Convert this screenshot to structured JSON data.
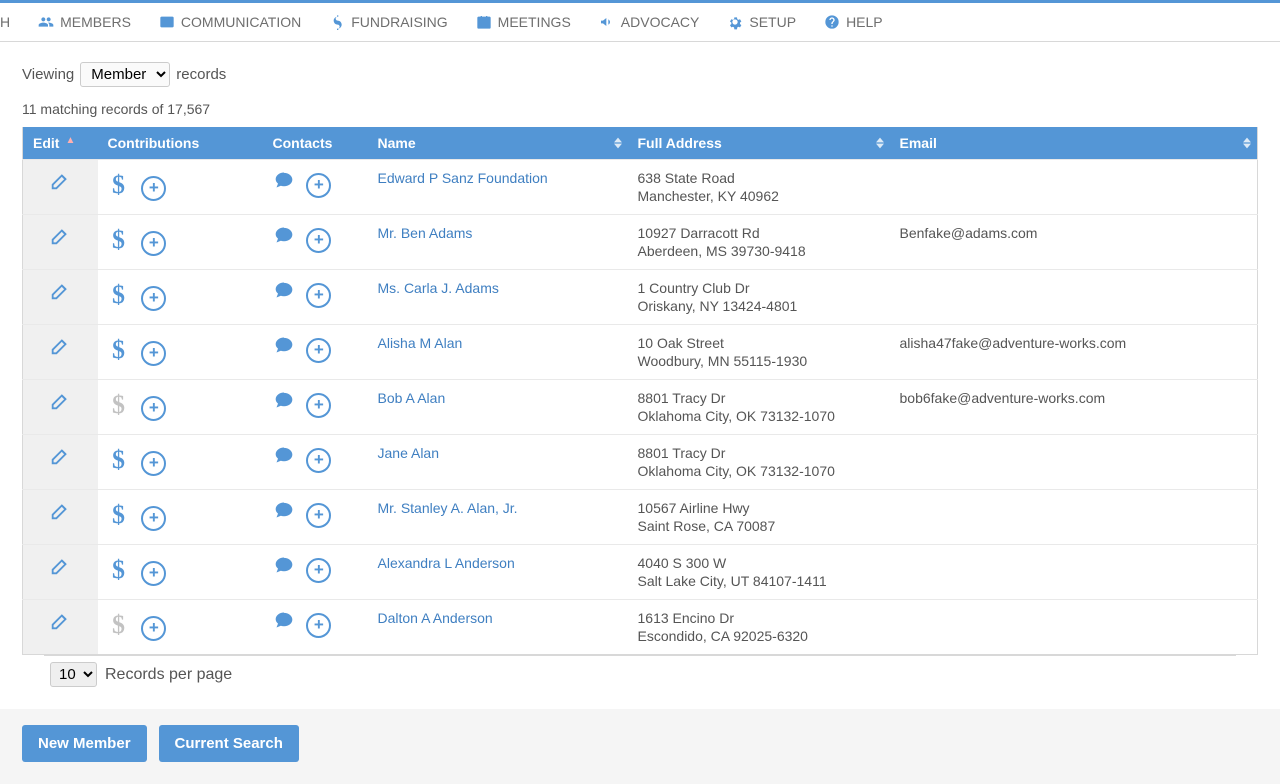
{
  "nav": {
    "search_fragment": "H",
    "members": "MEMBERS",
    "communication": "COMMUNICATION",
    "fundraising": "FUNDRAISING",
    "meetings": "MEETINGS",
    "advocacy": "ADVOCACY",
    "setup": "SETUP",
    "help": "HELP"
  },
  "viewing": {
    "label_prefix": "Viewing",
    "select_value": "Member",
    "label_suffix": "records",
    "match_count": "11 matching records of 17,567"
  },
  "columns": {
    "edit": "Edit",
    "contributions": "Contributions",
    "contacts": "Contacts",
    "name": "Name",
    "full_address": "Full Address",
    "email": "Email"
  },
  "rows": [
    {
      "name": "Edward P Sanz Foundation",
      "addr1": "638 State Road",
      "addr2": "Manchester, KY 40962",
      "email": "",
      "dollar_faded": false
    },
    {
      "name": "Mr. Ben Adams",
      "addr1": "10927 Darracott Rd",
      "addr2": "Aberdeen, MS 39730-9418",
      "email": "Benfake@adams.com",
      "dollar_faded": false
    },
    {
      "name": "Ms. Carla J. Adams",
      "addr1": "1 Country Club Dr",
      "addr2": "Oriskany, NY 13424-4801",
      "email": "",
      "dollar_faded": false
    },
    {
      "name": "Alisha M Alan",
      "addr1": "10 Oak Street",
      "addr2": "Woodbury, MN 55115-1930",
      "email": "alisha47fake@adventure-works.com",
      "dollar_faded": false
    },
    {
      "name": "Bob A Alan",
      "addr1": "8801 Tracy Dr",
      "addr2": "Oklahoma City, OK 73132-1070",
      "email": "bob6fake@adventure-works.com",
      "dollar_faded": true
    },
    {
      "name": "Jane Alan",
      "addr1": "8801 Tracy Dr",
      "addr2": "Oklahoma City, OK 73132-1070",
      "email": "",
      "dollar_faded": false
    },
    {
      "name": "Mr. Stanley A. Alan, Jr.",
      "addr1": "10567 Airline Hwy",
      "addr2": "Saint Rose, CA 70087",
      "email": "",
      "dollar_faded": false
    },
    {
      "name": "Alexandra L Anderson",
      "addr1": "4040 S 300 W",
      "addr2": "Salt Lake City, UT 84107-1411",
      "email": "",
      "dollar_faded": false
    },
    {
      "name": "Dalton A Anderson",
      "addr1": "1613 Encino Dr",
      "addr2": "Escondido, CA 92025-6320",
      "email": "",
      "dollar_faded": true
    }
  ],
  "pager": {
    "per_page_value": "10",
    "per_page_label": "Records per page"
  },
  "buttons": {
    "new_member": "New Member",
    "current_search": "Current Search"
  },
  "colors": {
    "primary": "#5496d6",
    "link": "#3f7fc1"
  }
}
